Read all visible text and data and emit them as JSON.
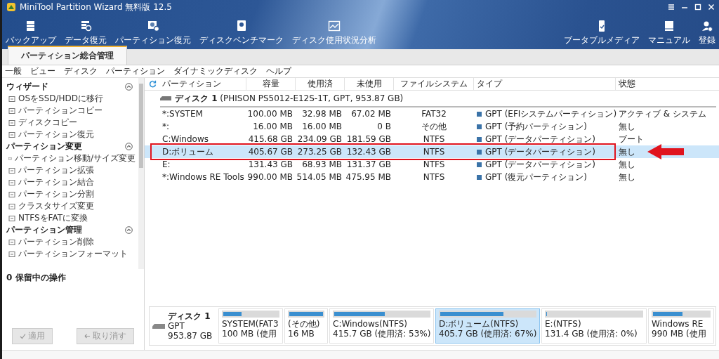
{
  "window": {
    "title": "MiniTool Partition Wizard 無料版 12.5"
  },
  "toolbar": {
    "items": [
      {
        "label": "バックアップ"
      },
      {
        "label": "データ復元"
      },
      {
        "label": "パーティション復元"
      },
      {
        "label": "ディスクベンチマーク"
      },
      {
        "label": "ディスク使用状況分析"
      }
    ],
    "right_items": [
      {
        "label": "ブータブルメディア"
      },
      {
        "label": "マニュアル"
      },
      {
        "label": "登録"
      }
    ]
  },
  "tabs": [
    {
      "label": "パーティション総合管理",
      "selected": true
    }
  ],
  "menu": [
    "一般",
    "ビュー",
    "ディスク",
    "パーティション",
    "ダイナミックディスク",
    "ヘルプ"
  ],
  "sidebar": {
    "sections": [
      {
        "title": "ウィザード",
        "expanded": true,
        "items": [
          "OSをSSD/HDDに移行",
          "パーティションコピー",
          "ディスクコピー",
          "パーティション復元"
        ]
      },
      {
        "title": "パーティション変更",
        "expanded": true,
        "items": [
          "パーティション移動/サイズ変更",
          "パーティション拡張",
          "パーティション結合",
          "パーティション分割",
          "クラスタサイズ変更",
          "NTFSをFATに変換"
        ]
      },
      {
        "title": "パーティション管理",
        "expanded": true,
        "items": [
          "パーティション削除",
          "パーティションフォーマット"
        ]
      }
    ],
    "pending": "0 保留中の操作",
    "buttons": [
      {
        "label": "適用",
        "disabled": true
      },
      {
        "label": "取り消す",
        "disabled": true
      }
    ]
  },
  "table": {
    "columns": [
      "パーティション",
      "容量",
      "使用済",
      "未使用",
      "ファイルシステム",
      "タイプ",
      "状態"
    ],
    "disk": "**ディスク 1** (PHISON PS5012-E12S-1T, GPT, 953.87 GB)",
    "rows": [
      {
        "cells": [
          "*:SYSTEM",
          "100.00 MB",
          "32.98 MB",
          "67.02 MB",
          "FAT32",
          "GPT (EFIシステムパーティション)",
          "アクティブ & システム"
        ],
        "selected": false
      },
      {
        "cells": [
          "*:",
          "16.00 MB",
          "16.00 MB",
          "0 B",
          "その他",
          "GPT (予約パーティション)",
          "無し"
        ],
        "selected": false
      },
      {
        "cells": [
          "C:Windows",
          "415.68 GB",
          "234.09 GB",
          "181.59 GB",
          "NTFS",
          "GPT (データパーティション)",
          "ブート"
        ],
        "selected": false
      },
      {
        "cells": [
          "D:ボリューム",
          "405.67 GB",
          "273.25 GB",
          "132.43 GB",
          "NTFS",
          "GPT (データパーティション)",
          "無し"
        ],
        "selected": true
      },
      {
        "cells": [
          "E:",
          "131.43 GB",
          "68.93 MB",
          "131.37 GB",
          "NTFS",
          "GPT (データパーティション)",
          "無し"
        ],
        "selected": false
      },
      {
        "cells": [
          "*:Windows RE Tools",
          "990.00 MB",
          "514.05 MB",
          "475.95 MB",
          "NTFS",
          "GPT (復元パーティション)",
          "無し"
        ],
        "selected": false
      }
    ]
  },
  "disk_map": {
    "disk": {
      "name": "ディスク 1",
      "type": "GPT",
      "size": "953.87 GB"
    },
    "segments": [
      {
        "label": "SYSTEM(FAT3",
        "detail": "100 MB (使用",
        "level": 0.33,
        "selected": false
      },
      {
        "label": "(その他)",
        "detail": "16 MB",
        "level": 1,
        "selected": false
      },
      {
        "label": "C:Windows(NTFS)",
        "detail": "415.7 GB (使用済: 53%)",
        "level": 0.53,
        "selected": false
      },
      {
        "label": "D:ボリューム(NTFS)",
        "detail": "405.7 GB (使用済: 67%)",
        "level": 0.67,
        "selected": true
      },
      {
        "label": "E:(NTFS)",
        "detail": "131.4 GB (使用済: 0%)",
        "level": 0,
        "selected": false
      },
      {
        "label": "Windows RE",
        "detail": "990 MB (使用",
        "level": 0.52,
        "selected": false
      }
    ]
  }
}
